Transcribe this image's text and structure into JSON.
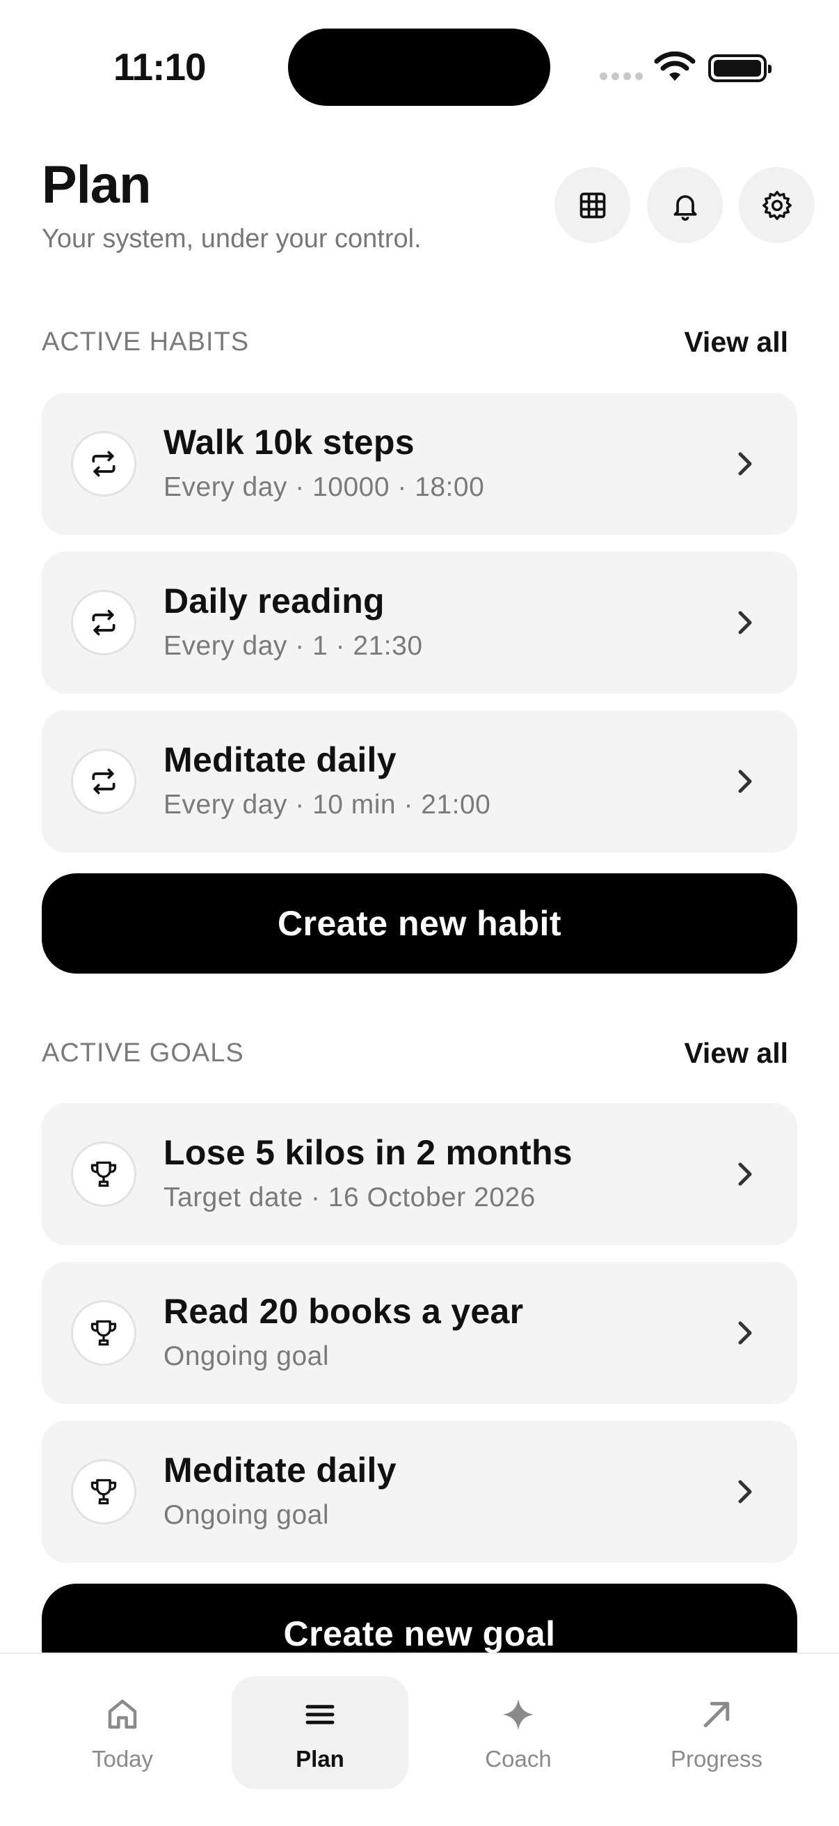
{
  "status_bar": {
    "time": "11:10"
  },
  "header": {
    "title": "Plan",
    "subtitle": "Your system, under your control.",
    "icons": [
      "grid-icon",
      "bell-icon",
      "gear-icon"
    ]
  },
  "habits": {
    "section_title": "ACTIVE HABITS",
    "view_all": "View all",
    "items": [
      {
        "title": "Walk 10k steps",
        "subtitle": "Every day · 10000 · 18:00"
      },
      {
        "title": "Daily reading",
        "subtitle": "Every day · 1 · 21:30"
      },
      {
        "title": "Meditate daily",
        "subtitle": "Every day · 10 min · 21:00"
      }
    ],
    "create_label": "Create new habit"
  },
  "goals": {
    "section_title": "ACTIVE GOALS",
    "view_all": "View all",
    "items": [
      {
        "title": "Lose 5 kilos in 2 months",
        "subtitle": "Target date · 16 October 2026"
      },
      {
        "title": "Read 20 books a year",
        "subtitle": "Ongoing goal"
      },
      {
        "title": "Meditate daily",
        "subtitle": "Ongoing goal"
      }
    ],
    "create_label": "Create new goal"
  },
  "tabbar": {
    "tabs": [
      {
        "label": "Today",
        "icon": "home-icon"
      },
      {
        "label": "Plan",
        "icon": "menu-icon",
        "active": true
      },
      {
        "label": "Coach",
        "icon": "sparkle-icon"
      },
      {
        "label": "Progress",
        "icon": "arrow-up-right-icon"
      }
    ]
  }
}
